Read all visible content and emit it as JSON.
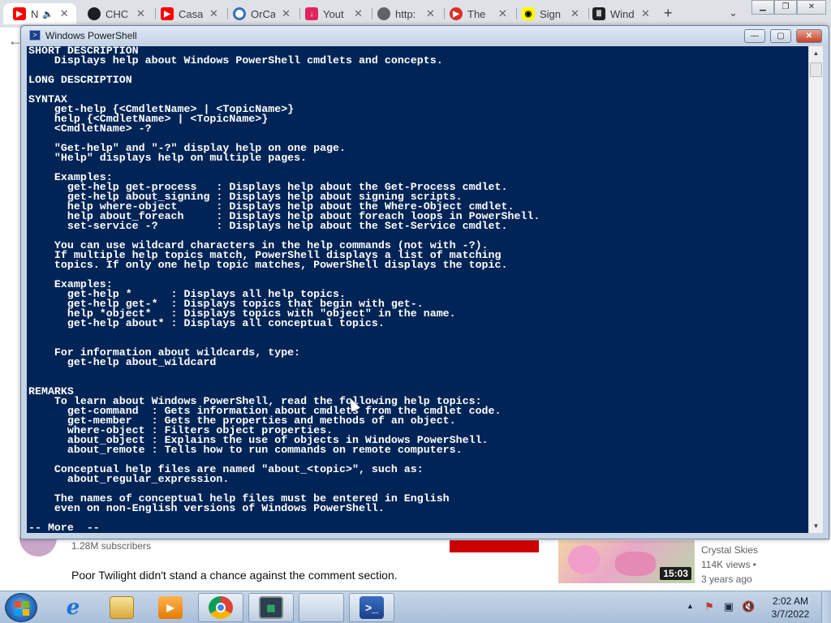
{
  "browser": {
    "tabs": [
      {
        "title": "N",
        "favicon": "youtube-icon",
        "color": "#ff0000"
      },
      {
        "title": "CHC",
        "favicon": "github-icon",
        "color": "#1b1f23"
      },
      {
        "title": "Casa",
        "favicon": "youtube-icon",
        "color": "#ff0000"
      },
      {
        "title": "OrCa",
        "favicon": "orcid-icon",
        "color": "#3b6fb6"
      },
      {
        "title": "Yout",
        "favicon": "download-icon",
        "color": "#e0245e"
      },
      {
        "title": "http:",
        "favicon": "globe-icon",
        "color": "#5f6368"
      },
      {
        "title": "The",
        "favicon": "youtube-icon",
        "color": "#d93025"
      },
      {
        "title": "Sign",
        "favicon": "snapchat-icon",
        "color": "#fffc00"
      },
      {
        "title": "Wind",
        "favicon": "library-icon",
        "color": "#202124"
      }
    ],
    "new_tab": "+",
    "tab_close": "✕",
    "tab_dropdown": "⌄",
    "back": "←"
  },
  "youtube": {
    "subscribers": "1.28M subscribers",
    "comment": "Poor Twilight didn't stand a chance against the comment section.",
    "duration": "15:03",
    "channel": "Crystal Skies",
    "views": "114K views •",
    "age": "3 years ago"
  },
  "powershell": {
    "title": "Windows PowerShell",
    "text": "SHORT DESCRIPTION\n    Displays help about Windows PowerShell cmdlets and concepts.\n\nLONG DESCRIPTION\n\nSYNTAX\n    get-help {<CmdletName> | <TopicName>}\n    help {<CmdletName> | <TopicName>}\n    <CmdletName> -?\n\n    \"Get-help\" and \"-?\" display help on one page.\n    \"Help\" displays help on multiple pages.\n\n    Examples:\n      get-help get-process   : Displays help about the Get-Process cmdlet.\n      get-help about_signing : Displays help about signing scripts.\n      help where-object      : Displays help about the Where-Object cmdlet.\n      help about_foreach     : Displays help about foreach loops in PowerShell.\n      set-service -?         : Displays help about the Set-Service cmdlet.\n\n    You can use wildcard characters in the help commands (not with -?).\n    If multiple help topics match, PowerShell displays a list of matching\n    topics. If only one help topic matches, PowerShell displays the topic.\n\n    Examples:\n      get-help *      : Displays all help topics.\n      get-help get-*  : Displays topics that begin with get-.\n      help *object*   : Displays topics with \"object\" in the name.\n      get-help about* : Displays all conceptual topics.\n\n\n    For information about wildcards, type:\n      get-help about_wildcard\n\n\nREMARKS\n    To learn about Windows PowerShell, read the following help topics:\n      get-command  : Gets information about cmdlets from the cmdlet code.\n      get-member   : Gets the properties and methods of an object.\n      where-object : Filters object properties.\n      about_object : Explains the use of objects in Windows PowerShell.\n      about_remote : Tells how to run commands on remote computers.\n\n    Conceptual help files are named \"about_<topic>\", such as:\n      about_regular_expression.\n\n    The names of conceptual help files must be entered in English\n    even on non-English versions of Windows PowerShell.\n\n-- More  --",
    "colors": {
      "background": "#012456",
      "foreground": "#ffffff"
    }
  },
  "taskbar": {
    "items": [
      {
        "name": "internet-explorer-icon",
        "open": false
      },
      {
        "name": "file-explorer-icon",
        "open": false
      },
      {
        "name": "media-player-icon",
        "open": false
      },
      {
        "name": "chrome-icon",
        "open": true
      },
      {
        "name": "system-monitor-icon",
        "open": true
      },
      {
        "name": "windows-app-icon",
        "open": true
      },
      {
        "name": "powershell-icon",
        "open": true
      }
    ],
    "time": "2:02 AM",
    "date": "3/7/2022"
  }
}
